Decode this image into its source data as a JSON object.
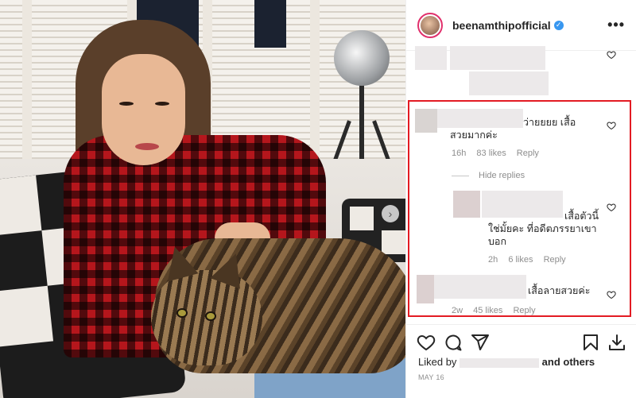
{
  "post": {
    "username": "beenamthipofficial",
    "more_label": "•••"
  },
  "comments": [
    {
      "text": "ว่ายยยย เสื้อสวยมากค่ะ",
      "time": "16h",
      "likes": "83 likes",
      "reply": "Reply"
    },
    {
      "text": "เสื้อตัวนี้ใช่มั้ยคะ ที่อดีตภรรยาเขาบอก",
      "time": "2h",
      "likes": "6 likes",
      "reply": "Reply"
    },
    {
      "text": "เสื้อลายสวยค่ะ",
      "time": "2w",
      "likes": "45 likes",
      "reply": "Reply"
    }
  ],
  "hide_replies": "Hide replies",
  "footer": {
    "liked_by_prefix": "Liked by",
    "and_others": "and others",
    "date": "MAY 16"
  },
  "colors": {
    "highlight": "#e31b23",
    "verified": "#3897f0"
  }
}
